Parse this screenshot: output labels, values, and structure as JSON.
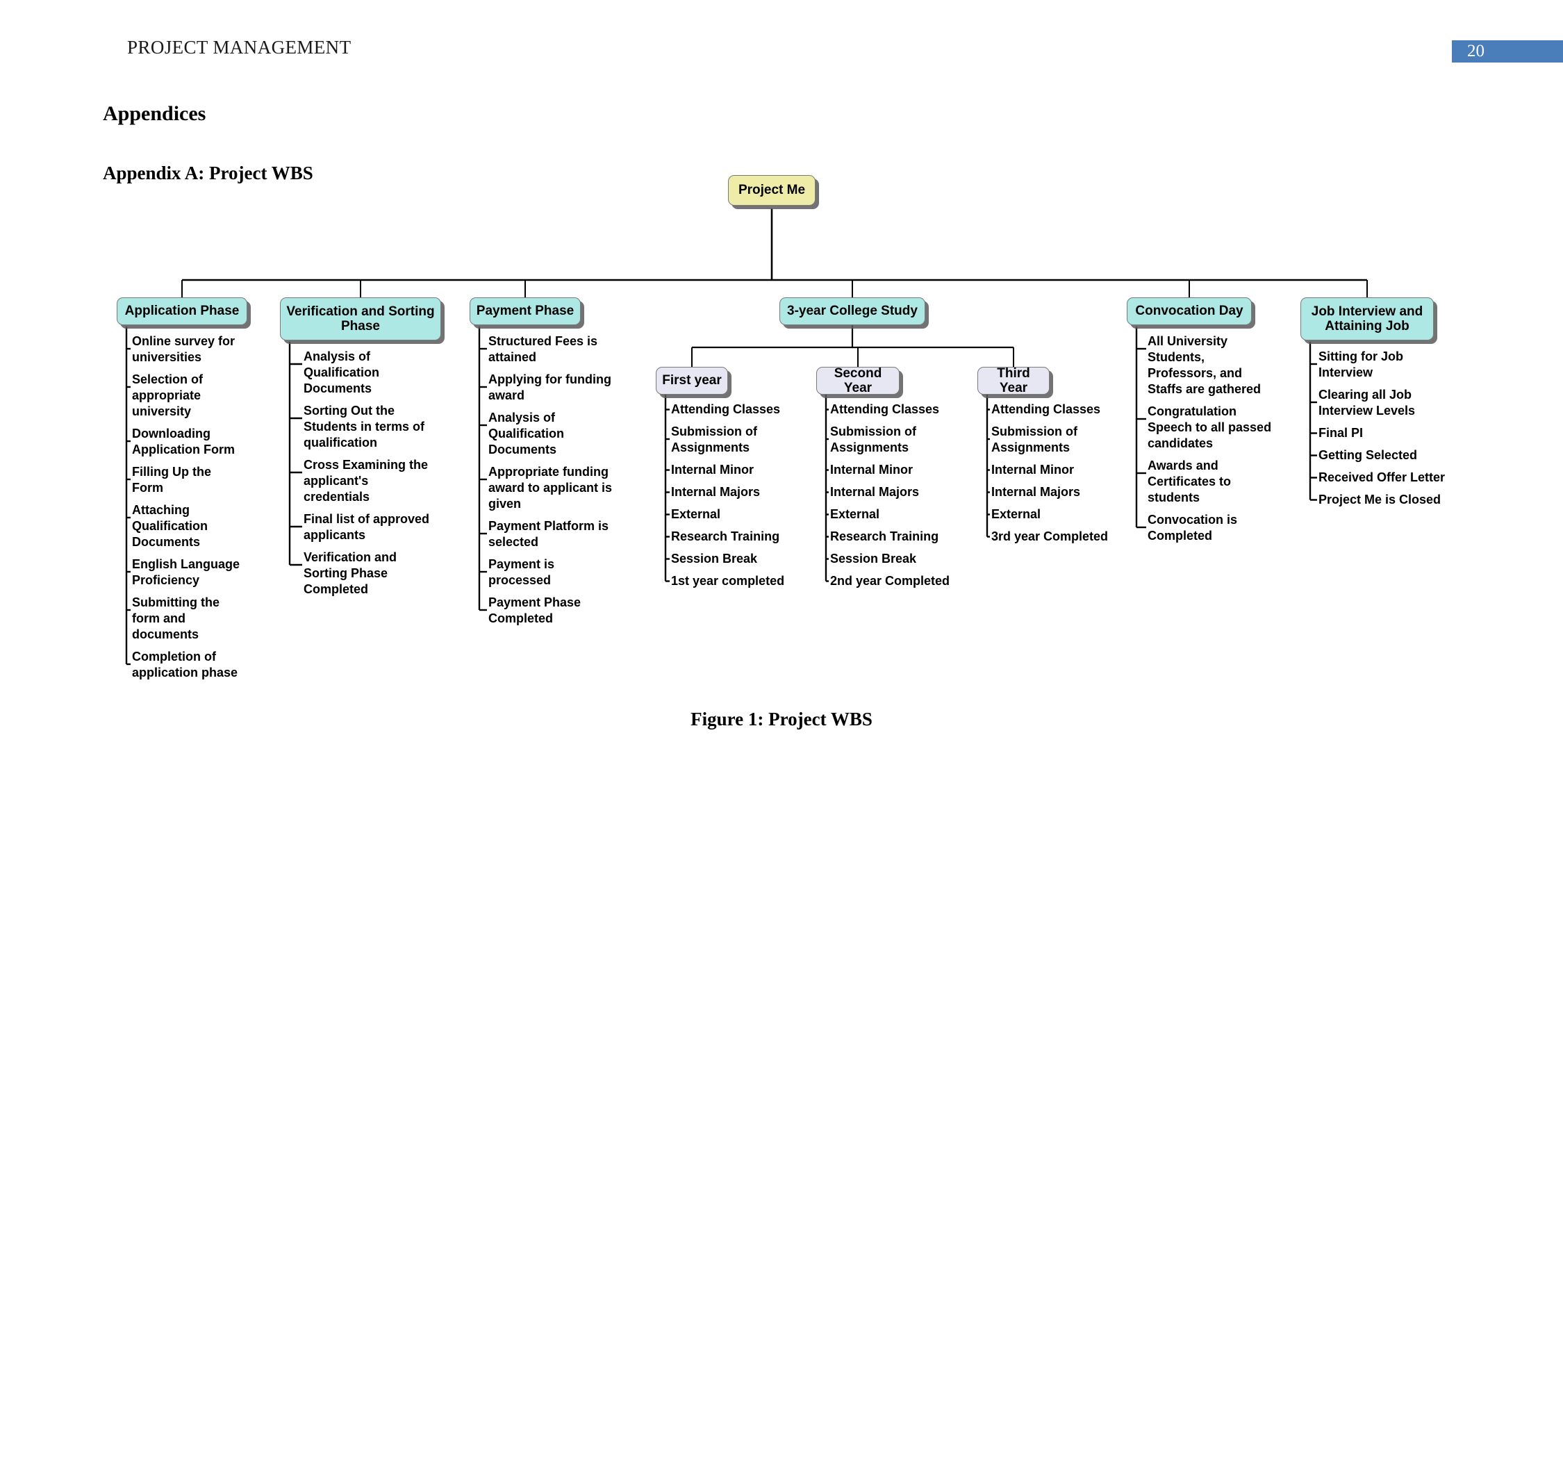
{
  "header": {
    "running_head": "PROJECT MANAGEMENT",
    "page_number": "20",
    "badge_color": "#4a7ebb"
  },
  "headings": {
    "appendices": "Appendices",
    "appendix_a": "Appendix A: Project WBS"
  },
  "figure": {
    "caption": "Figure 1: Project WBS"
  },
  "colors": {
    "root_node": "#efeca8",
    "phase_node": "#aee8e4",
    "year_node": "#e7e6f3",
    "connector": "#000000",
    "shadow": "#5a5a5a"
  },
  "wbs": {
    "root": {
      "label": "Project Me"
    },
    "branches": [
      {
        "label": "Application Phase",
        "items": [
          "Online survey for universities",
          "Selection of appropriate university",
          "Downloading Application Form",
          "Filling Up the Form",
          "Attaching Qualification Documents",
          "English Language Proficiency",
          "Submitting the form and documents",
          "Completion of application phase"
        ]
      },
      {
        "label": "Verification and Sorting Phase",
        "items": [
          "Analysis of Qualification Documents",
          "Sorting Out the Students in terms of qualification",
          "Cross Examining the applicant's credentials",
          "Final list of approved applicants",
          "Verification and Sorting Phase Completed"
        ]
      },
      {
        "label": "Payment Phase",
        "items": [
          "Structured Fees is attained",
          "Applying for funding award",
          "Analysis of Qualification Documents",
          "Appropriate funding award to applicant is given",
          "Payment Platform is selected",
          "Payment is processed",
          "Payment Phase Completed"
        ]
      },
      {
        "label": "3-year College Study",
        "items": [],
        "children": [
          {
            "label": "First year",
            "items": [
              "Attending Classes",
              "Submission of Assignments",
              "Internal Minor",
              "Internal Majors",
              "External",
              "Research Training",
              "Session Break",
              "1st year completed"
            ]
          },
          {
            "label": "Second Year",
            "items": [
              "Attending Classes",
              "Submission of Assignments",
              "Internal Minor",
              "Internal Majors",
              "External",
              "Research Training",
              "Session Break",
              "2nd year Completed"
            ]
          },
          {
            "label": "Third Year",
            "items": [
              "Attending Classes",
              "Submission of Assignments",
              "Internal Minor",
              "Internal Majors",
              "External",
              "3rd year Completed"
            ]
          }
        ]
      },
      {
        "label": "Convocation Day",
        "items": [
          "All University Students, Professors, and Staffs are gathered",
          "Congratulation Speech to all passed candidates",
          "Awards and Certificates to students",
          "Convocation is Completed"
        ]
      },
      {
        "label": "Job Interview and Attaining Job",
        "items": [
          "Sitting for Job Interview",
          "Clearing all Job Interview Levels",
          "Final PI",
          "Getting Selected",
          "Received Offer Letter",
          "Project Me is Closed"
        ]
      }
    ]
  }
}
